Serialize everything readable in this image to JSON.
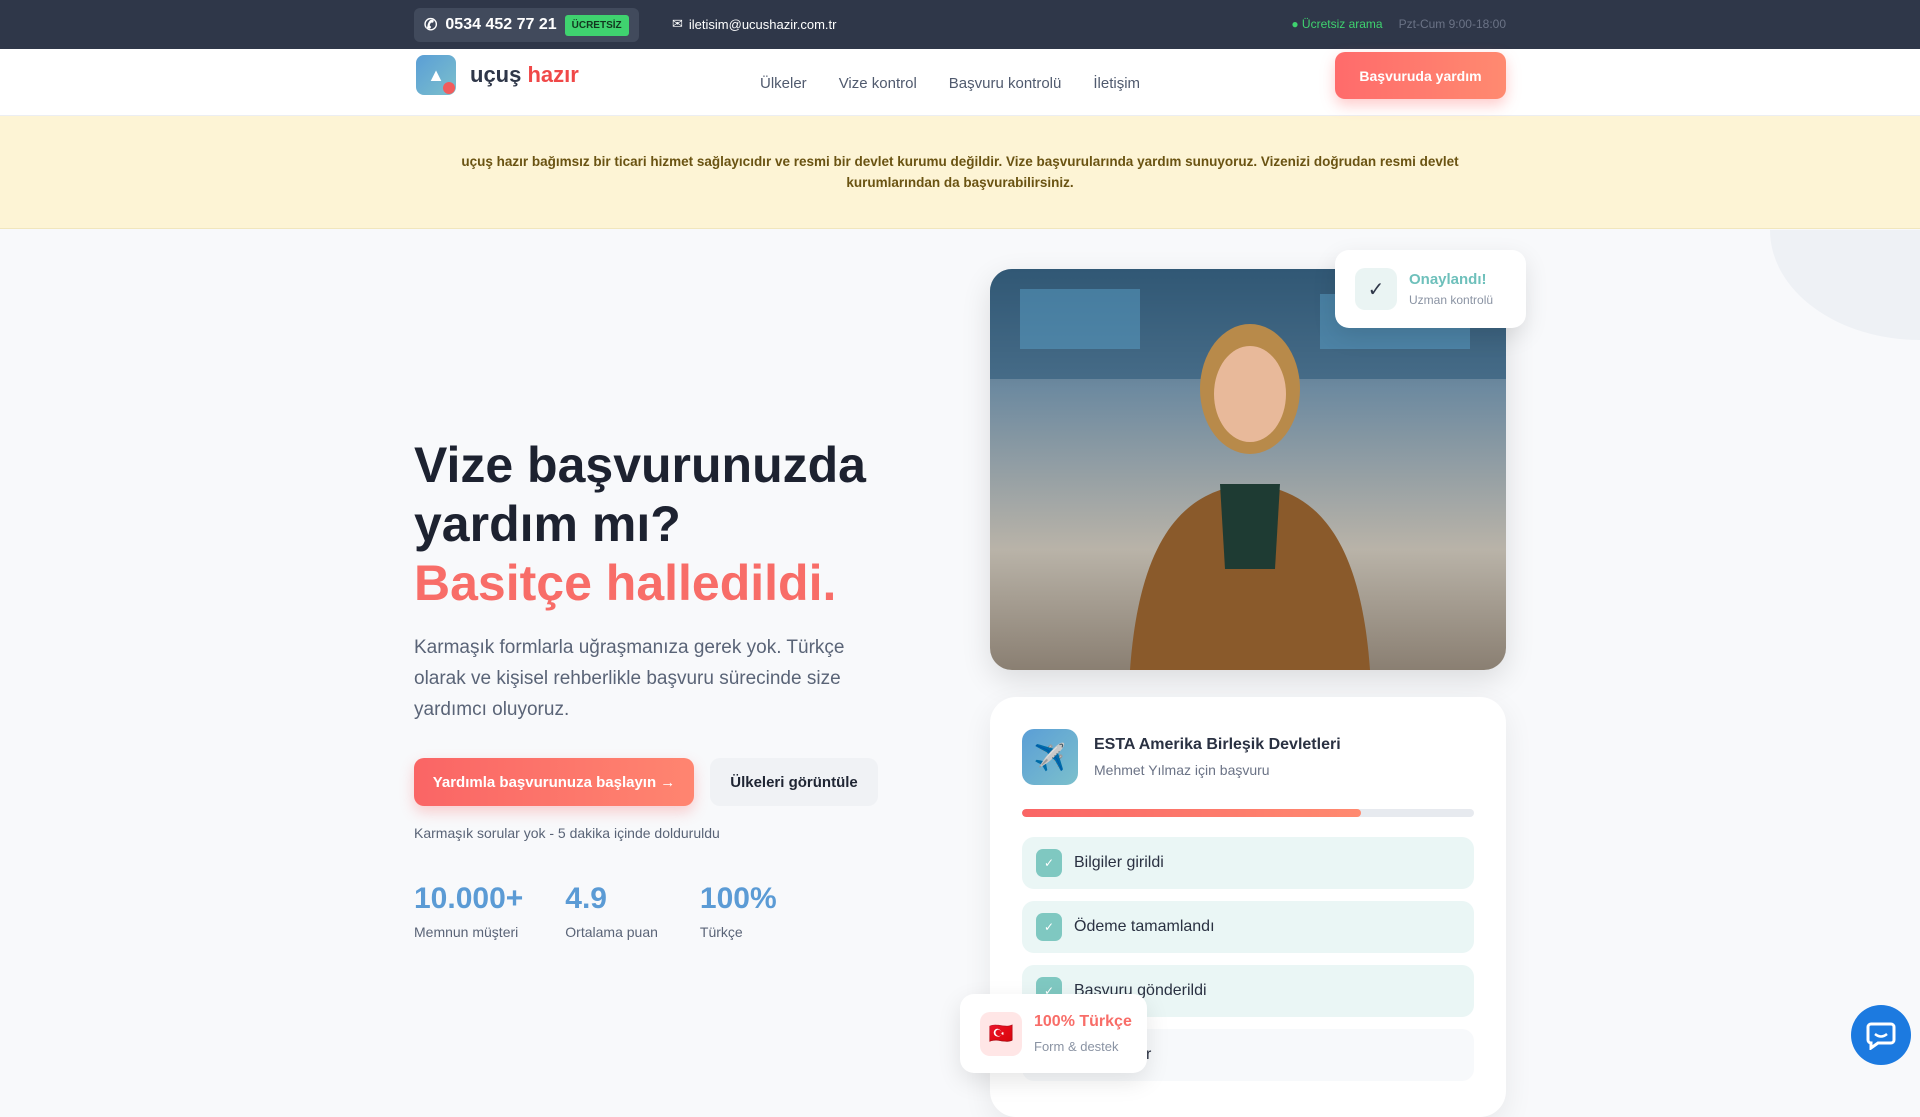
{
  "topbar": {
    "phone": "0534 452 77 21",
    "free_badge": "ÜCRETSİZ",
    "email": "iletisim@ucushazir.com.tr",
    "free_call": "Ücretsiz arama",
    "hours": "Pzt-Cum 9:00-18:00"
  },
  "nav": {
    "logo_main": "uçuş",
    "logo_accent": "hazır",
    "menu": [
      "Ülkeler",
      "Vize kontrol",
      "Başvuru kontrolü",
      "İletişim"
    ],
    "cta": "Başvuruda yardım"
  },
  "notice": "uçuş hazır bağımsız bir ticari hizmet sağlayıcıdır ve resmi bir devlet kurumu değildir. Vize başvurularında yardım sunuyoruz. Vizenizi doğrudan resmi devlet kurumlarından da başvurabilirsiniz.",
  "hero": {
    "title_line1": "Vize başvurunuzda",
    "title_line2": "yardım mı?",
    "title_accent": "Basitçe halledildi.",
    "lead": "Karmaşık formlarla uğraşmanıza gerek yok. Türkçe olarak ve kişisel rehberlikle başvuru sürecinde size yardımcı oluyoruz.",
    "primary_button": "Yardımla başvurunuza başlayın →",
    "secondary_button": "Ülkeleri görüntüle",
    "note": "Karmaşık sorular yok - 5 dakika içinde dolduruldu",
    "stats": [
      {
        "value": "10.000+",
        "label": "Memnun müşteri"
      },
      {
        "value": "4.9",
        "label": "Ortalama puan"
      },
      {
        "value": "100%",
        "label": "Türkçe"
      }
    ]
  },
  "approved": {
    "title": "Onaylandı!",
    "subtitle": "Uzman kontrolü"
  },
  "application": {
    "title": "ESTA Amerika Birleşik Devletleri",
    "subtitle": "Mehmet Yılmaz için başvuru",
    "progress_percent": 75,
    "steps": [
      {
        "label": "Bilgiler girildi",
        "done": true
      },
      {
        "label": "Ödeme tamamlandı",
        "done": true
      },
      {
        "label": "Başvuru gönderildi",
        "done": true
      },
      {
        "label": "İnceleniyor",
        "done": false
      }
    ]
  },
  "turkish_badge": {
    "title": "100% Türkçe",
    "subtitle": "Form & destek"
  }
}
